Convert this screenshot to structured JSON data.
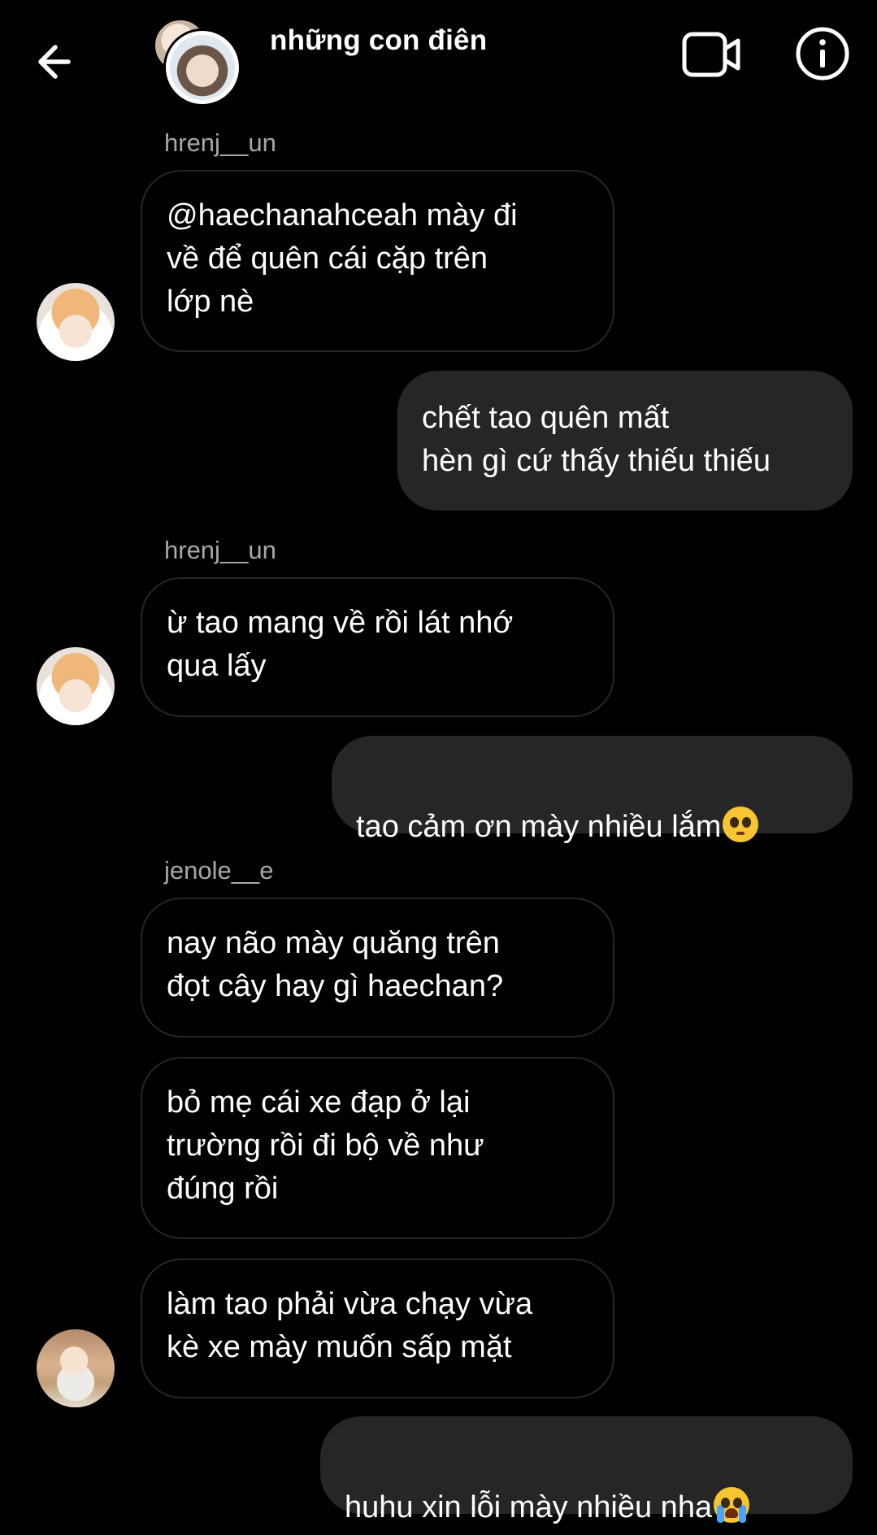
{
  "header": {
    "title": "những con điên",
    "back_icon": "arrow-left-icon",
    "video_icon": "video-call-icon",
    "info_icon": "info-icon"
  },
  "messages": [
    {
      "type": "received",
      "sender": "hrenj__un",
      "text": "@haechanahceah mày đi\nvề để quên cái cặp trên\nlớp nè"
    },
    {
      "type": "sent",
      "text": "chết tao quên mất\nhèn gì cứ thấy thiếu thiếu"
    },
    {
      "type": "received",
      "sender": "hrenj__un",
      "text": "ừ tao mang về rồi lát nhớ\nqua lấy"
    },
    {
      "type": "sent",
      "text": "tao cảm ơn mày nhiều lắm",
      "emoji": "pleading-face-emoji"
    },
    {
      "type": "received",
      "sender": "jenole__e",
      "text": "nay não mày quăng trên\nđọt cây hay gì haechan?"
    },
    {
      "type": "received",
      "text": "bỏ mẹ cái xe đạp ở lại\ntrường rồi đi bộ về như\nđúng rồi"
    },
    {
      "type": "received",
      "text": "làm tao phải vừa chạy vừa\nkè xe mày muốn sấp mặt"
    },
    {
      "type": "sent",
      "text": "huhu xin lỗi mày nhiều nha",
      "emoji": "loudly-crying-face-emoji"
    }
  ]
}
